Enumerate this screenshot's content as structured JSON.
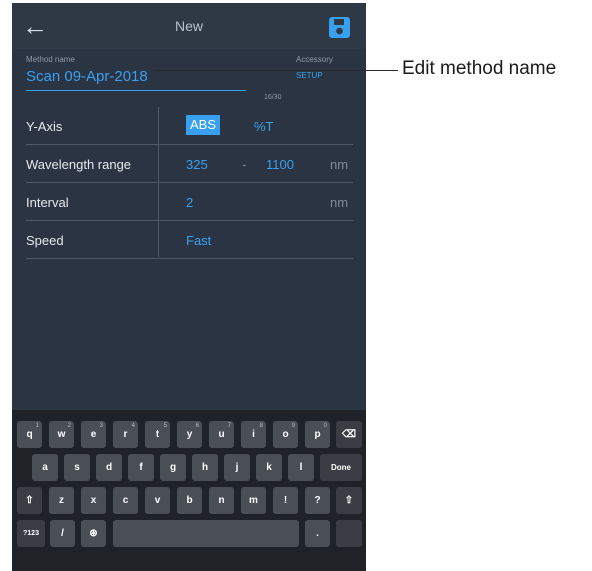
{
  "header": {
    "title": "New"
  },
  "method": {
    "label": "Method name",
    "value": "Scan 09-Apr-2018",
    "counter": "16/30",
    "accessory_label": "Accessory",
    "accessory_action": "SETUP"
  },
  "rows": {
    "yaxis": {
      "label": "Y-Axis",
      "option_abs": "ABS",
      "option_t": "%T",
      "selected": "ABS"
    },
    "wavelength": {
      "label": "Wavelength range",
      "from": "325",
      "sep": "-",
      "to": "1100",
      "unit": "nm"
    },
    "interval": {
      "label": "Interval",
      "value": "2",
      "unit": "nm"
    },
    "speed": {
      "label": "Speed",
      "value": "Fast"
    }
  },
  "keyboard": {
    "row1": [
      "q",
      "w",
      "e",
      "r",
      "t",
      "y",
      "u",
      "i",
      "o",
      "p",
      "⌫"
    ],
    "row1_hints": [
      "1",
      "2",
      "3",
      "4",
      "5",
      "6",
      "7",
      "8",
      "9",
      "0",
      ""
    ],
    "row2": [
      "a",
      "s",
      "d",
      "f",
      "g",
      "h",
      "j",
      "k",
      "l",
      "Done"
    ],
    "row3": [
      "⇧",
      "z",
      "x",
      "c",
      "v",
      "b",
      "n",
      "m",
      "!",
      "?",
      "⇧"
    ],
    "row4": [
      "?123",
      "/",
      "⊛",
      "",
      ".",
      ""
    ]
  },
  "callout": {
    "text": "Edit method name"
  },
  "colors": {
    "accent": "#38a0f0",
    "background": "#2b3442",
    "keyboard": "#1f2328"
  }
}
